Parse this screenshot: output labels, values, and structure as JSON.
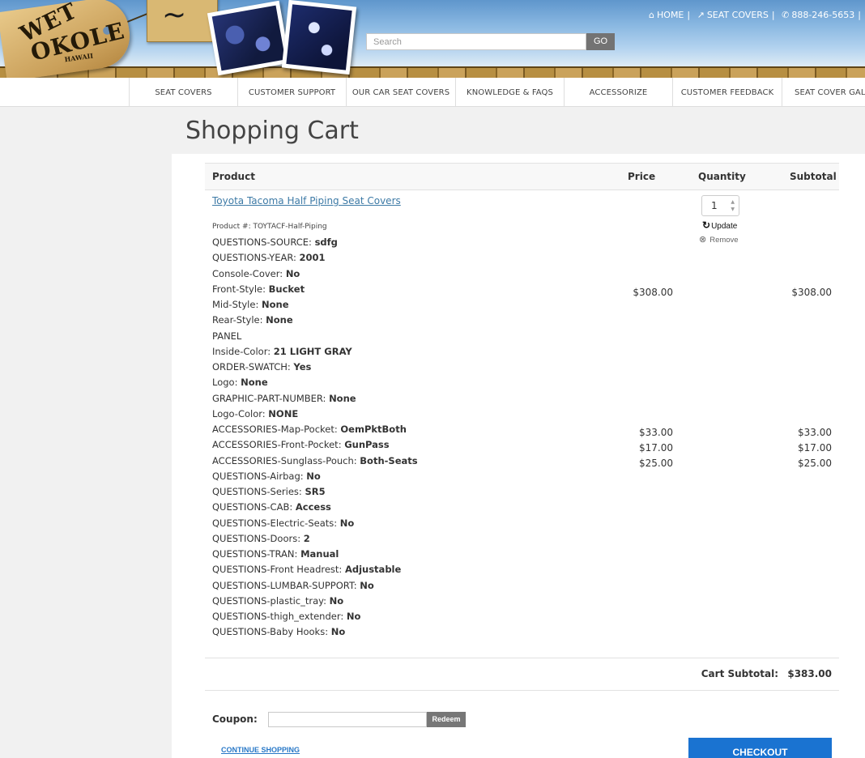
{
  "brand": {
    "line1": "WET",
    "line2": "OKOLE",
    "line3": "HAWAII"
  },
  "topnav": {
    "home": "HOME",
    "seat_covers": "SEAT COVERS",
    "phone": "888-246-5653",
    "separator": "|"
  },
  "search": {
    "placeholder": "Search",
    "go_label": "GO"
  },
  "nav": {
    "items": [
      "SEAT COVERS",
      "CUSTOMER SUPPORT",
      "OUR CAR SEAT COVERS",
      "KNOWLEDGE & FAQS",
      "ACCESSORIZE",
      "CUSTOMER FEEDBACK",
      "SEAT COVER GALLI"
    ]
  },
  "page": {
    "title": "Shopping Cart"
  },
  "table": {
    "headers": {
      "product": "Product",
      "price": "Price",
      "quantity": "Quantity",
      "subtotal": "Subtotal"
    }
  },
  "item": {
    "name": "Toyota Tacoma Half Piping Seat Covers",
    "product_number": "Product #: TOYTACF-Half-Piping",
    "quantity": "1",
    "update_label": "Update",
    "remove_label": "Remove",
    "main_price": "$308.00",
    "main_subtotal": "$308.00",
    "options": [
      {
        "label": "QUESTIONS-SOURCE: ",
        "value": "sdfg"
      },
      {
        "label": "QUESTIONS-YEAR: ",
        "value": "2001"
      },
      {
        "label": "Console-Cover: ",
        "value": "No"
      },
      {
        "label": "Front-Style: ",
        "value": "Bucket"
      },
      {
        "label": "Mid-Style: ",
        "value": "None"
      },
      {
        "label": "Rear-Style: ",
        "value": "None"
      },
      {
        "label": "PANEL",
        "value": ""
      },
      {
        "label": "Inside-Color: ",
        "value": "21 LIGHT GRAY"
      },
      {
        "label": "ORDER-SWATCH: ",
        "value": "Yes"
      },
      {
        "label": "Logo: ",
        "value": "None"
      },
      {
        "label": "GRAPHIC-PART-NUMBER: ",
        "value": "None"
      },
      {
        "label": "Logo-Color: ",
        "value": "NONE"
      },
      {
        "label": "ACCESSORIES-Map-Pocket: ",
        "value": "OemPktBoth"
      },
      {
        "label": "ACCESSORIES-Front-Pocket: ",
        "value": "GunPass"
      },
      {
        "label": "ACCESSORIES-Sunglass-Pouch: ",
        "value": "Both-Seats"
      },
      {
        "label": "QUESTIONS-Airbag: ",
        "value": "No"
      },
      {
        "label": "QUESTIONS-Series: ",
        "value": "SR5"
      },
      {
        "label": "QUESTIONS-CAB: ",
        "value": "Access"
      },
      {
        "label": "QUESTIONS-Electric-Seats: ",
        "value": "No"
      },
      {
        "label": "QUESTIONS-Doors: ",
        "value": "2"
      },
      {
        "label": "QUESTIONS-TRAN: ",
        "value": "Manual"
      },
      {
        "label": "QUESTIONS-Front Headrest: ",
        "value": "Adjustable"
      },
      {
        "label": "QUESTIONS-LUMBAR-SUPPORT: ",
        "value": "No"
      },
      {
        "label": "QUESTIONS-plastic_tray: ",
        "value": "No"
      },
      {
        "label": "QUESTIONS-thigh_extender: ",
        "value": "No"
      },
      {
        "label": "QUESTIONS-Baby Hooks: ",
        "value": "No"
      }
    ],
    "accessory_prices": [
      {
        "price": "$33.00",
        "subtotal": "$33.00"
      },
      {
        "price": "$17.00",
        "subtotal": "$17.00"
      },
      {
        "price": "$25.00",
        "subtotal": "$25.00"
      }
    ]
  },
  "summary": {
    "label": "Cart Subtotal:",
    "amount": "$383.00"
  },
  "coupon": {
    "label": "Coupon:",
    "value": "",
    "redeem_label": "Redeem"
  },
  "actions": {
    "continue_label": "CONTINUE SHOPPING",
    "checkout_label": "CHECKOUT"
  },
  "colors": {
    "link": "#3d7aa6",
    "checkout": "#1a73d1",
    "nav_text": "#444444"
  }
}
